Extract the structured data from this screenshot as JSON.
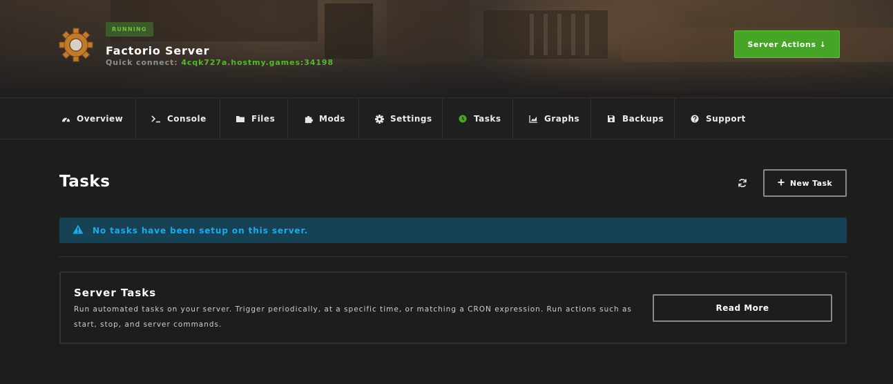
{
  "header": {
    "status": "RUNNING",
    "server_name": "Factorio Server",
    "quick_connect_label": "Quick connect:",
    "quick_connect_address": "4cqk727a.hostmy.games:34198",
    "actions_label": "Server Actions",
    "actions_arrow": "↓"
  },
  "nav": {
    "items": [
      {
        "label": "Overview",
        "icon": "dashboard-icon"
      },
      {
        "label": "Console",
        "icon": "terminal-icon"
      },
      {
        "label": "Files",
        "icon": "folder-icon"
      },
      {
        "label": "Mods",
        "icon": "puzzle-icon"
      },
      {
        "label": "Settings",
        "icon": "gear-icon"
      },
      {
        "label": "Tasks",
        "icon": "clock-icon",
        "active": true
      },
      {
        "label": "Graphs",
        "icon": "chart-icon"
      },
      {
        "label": "Backups",
        "icon": "save-icon"
      },
      {
        "label": "Support",
        "icon": "question-icon"
      }
    ]
  },
  "main": {
    "title": "Tasks",
    "new_task_label": "New Task",
    "alert_text": "No tasks have been setup on this server.",
    "info": {
      "title": "Server Tasks",
      "text": "Run automated tasks on your server. Trigger periodically, at a specific time, or matching a CRON expression. Run actions such as start, stop, and server commands.",
      "read_more_label": "Read More"
    }
  },
  "colors": {
    "accent_green": "#46a526",
    "status_green": "#6fbf3b",
    "alert_bg": "#174256",
    "alert_text": "#1eaae6",
    "background": "#1d1d1d"
  }
}
